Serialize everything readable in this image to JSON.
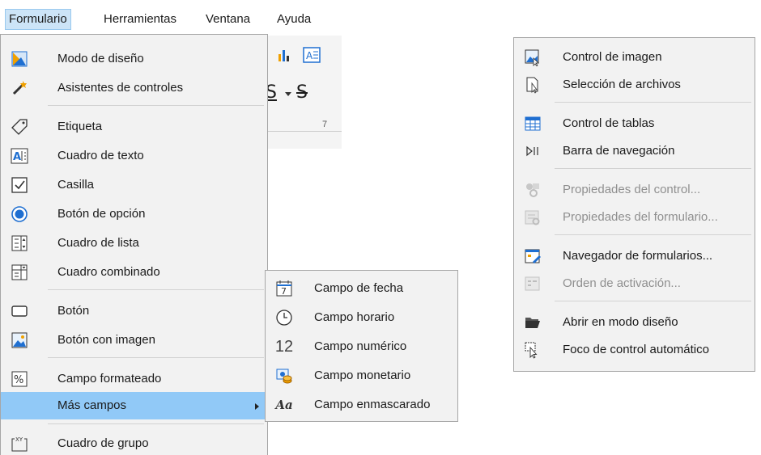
{
  "menubar": {
    "items": [
      {
        "label": "Formulario",
        "active": true
      },
      {
        "label": "Herramientas"
      },
      {
        "label": "Ventana"
      },
      {
        "label": "Ayuda"
      }
    ]
  },
  "toolbar_bg": {
    "s_underline": "S",
    "s_strike": "S",
    "ruler_num": "7"
  },
  "main_menu": {
    "items": [
      {
        "label": "Modo de diseño",
        "icon": "design-mode-icon"
      },
      {
        "label": "Asistentes de controles",
        "icon": "wizard-wand-icon"
      },
      {
        "label": "Etiqueta",
        "icon": "label-tag-icon"
      },
      {
        "label": "Cuadro de texto",
        "icon": "text-box-icon"
      },
      {
        "label": "Casilla",
        "icon": "checkbox-icon"
      },
      {
        "label": "Botón de opción",
        "icon": "radio-button-icon"
      },
      {
        "label": "Cuadro de lista",
        "icon": "list-box-icon"
      },
      {
        "label": "Cuadro combinado",
        "icon": "combo-box-icon"
      },
      {
        "label": "Botón",
        "icon": "push-button-icon"
      },
      {
        "label": "Botón con imagen",
        "icon": "image-button-icon"
      },
      {
        "label": "Campo formateado",
        "icon": "formatted-field-icon"
      },
      {
        "label": "Más campos",
        "icon": "",
        "submenu": true
      },
      {
        "label": "Cuadro de grupo",
        "icon": "group-box-icon"
      }
    ]
  },
  "sub_menu": {
    "items": [
      {
        "label": "Campo de fecha",
        "icon": "date-field-icon"
      },
      {
        "label": "Campo horario",
        "icon": "clock-icon"
      },
      {
        "label": "Campo numérico",
        "icon": "numeric-icon",
        "glyph": "12"
      },
      {
        "label": "Campo monetario",
        "icon": "currency-icon"
      },
      {
        "label": "Campo enmascarado",
        "icon": "masked-field-icon",
        "glyph": "Aa"
      }
    ]
  },
  "right_menu": {
    "items": [
      {
        "label": "Control de imagen",
        "icon": "image-control-icon"
      },
      {
        "label": "Selección de archivos",
        "icon": "file-selection-icon"
      },
      {
        "label": "Control de tablas",
        "icon": "table-control-icon"
      },
      {
        "label": "Barra de navegación",
        "icon": "navigation-bar-icon"
      },
      {
        "label": "Propiedades del control...",
        "icon": "control-properties-icon",
        "disabled": true
      },
      {
        "label": "Propiedades del formulario...",
        "icon": "form-properties-icon",
        "disabled": true
      },
      {
        "label": "Navegador de formularios...",
        "icon": "form-navigator-icon"
      },
      {
        "label": "Orden de activación...",
        "icon": "activation-order-icon",
        "disabled": true
      },
      {
        "label": "Abrir en modo diseño",
        "icon": "folder-open-icon"
      },
      {
        "label": "Foco de control automático",
        "icon": "auto-focus-icon"
      }
    ]
  },
  "colors": {
    "highlight": "#91c9f7",
    "menu_bg": "#f2f2f2",
    "accent_blue": "#1f6fd1"
  }
}
